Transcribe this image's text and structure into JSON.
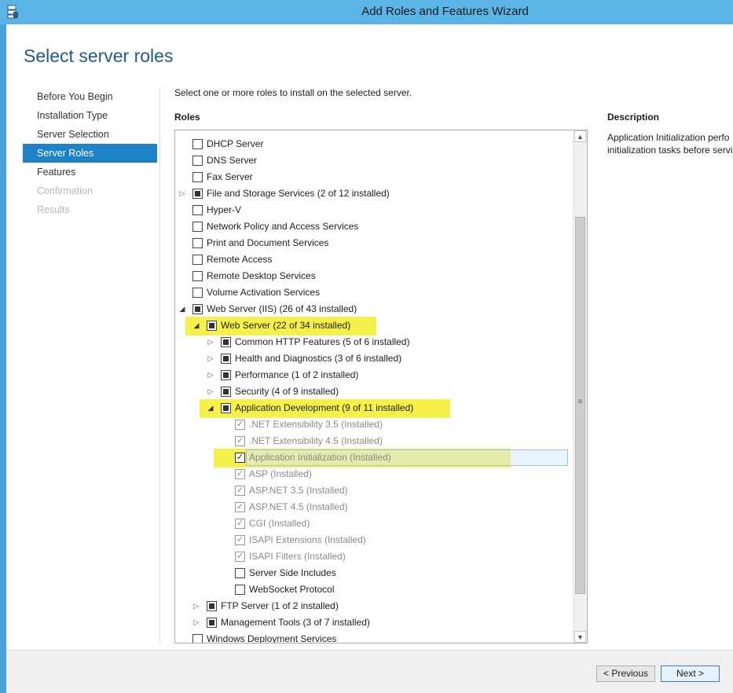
{
  "window": {
    "title": "Add Roles and Features Wizard"
  },
  "page": {
    "title": "Select server roles"
  },
  "nav": [
    {
      "label": "Before You Begin",
      "state": "normal"
    },
    {
      "label": "Installation Type",
      "state": "normal"
    },
    {
      "label": "Server Selection",
      "state": "normal"
    },
    {
      "label": "Server Roles",
      "state": "active"
    },
    {
      "label": "Features",
      "state": "normal"
    },
    {
      "label": "Confirmation",
      "state": "disabled"
    },
    {
      "label": "Results",
      "state": "disabled"
    }
  ],
  "instruction": "Select one or more roles to install on the selected server.",
  "roles_label": "Roles",
  "description": {
    "label": "Description",
    "text": "Application Initialization perfo\ninitialization tasks before servi"
  },
  "roles": [
    {
      "label": "DHCP Server",
      "level": 0,
      "expander": "none",
      "check": "empty"
    },
    {
      "label": "DNS Server",
      "level": 0,
      "expander": "none",
      "check": "empty"
    },
    {
      "label": "Fax Server",
      "level": 0,
      "expander": "none",
      "check": "empty"
    },
    {
      "label": "File and Storage Services (2 of 12 installed)",
      "level": 0,
      "expander": "collapsed",
      "check": "indeterminate"
    },
    {
      "label": "Hyper-V",
      "level": 0,
      "expander": "none",
      "check": "empty"
    },
    {
      "label": "Network Policy and Access Services",
      "level": 0,
      "expander": "none",
      "check": "empty"
    },
    {
      "label": "Print and Document Services",
      "level": 0,
      "expander": "none",
      "check": "empty"
    },
    {
      "label": "Remote Access",
      "level": 0,
      "expander": "none",
      "check": "empty"
    },
    {
      "label": "Remote Desktop Services",
      "level": 0,
      "expander": "none",
      "check": "empty"
    },
    {
      "label": "Volume Activation Services",
      "level": 0,
      "expander": "none",
      "check": "empty"
    },
    {
      "label": "Web Server (IIS) (26 of 43 installed)",
      "level": 0,
      "expander": "expanded",
      "check": "indeterminate"
    },
    {
      "label": "Web Server (22 of 34 installed)",
      "level": 1,
      "expander": "expanded",
      "check": "indeterminate",
      "highlight": true
    },
    {
      "label": "Common HTTP Features (5 of 6 installed)",
      "level": 2,
      "expander": "collapsed",
      "check": "indeterminate"
    },
    {
      "label": "Health and Diagnostics (3 of 6 installed)",
      "level": 2,
      "expander": "collapsed",
      "check": "indeterminate"
    },
    {
      "label": "Performance (1 of 2 installed)",
      "level": 2,
      "expander": "collapsed",
      "check": "indeterminate"
    },
    {
      "label": "Security (4 of 9 installed)",
      "level": 2,
      "expander": "collapsed",
      "check": "indeterminate"
    },
    {
      "label": "Application Development (9 of 11 installed)",
      "level": 2,
      "expander": "expanded",
      "check": "indeterminate",
      "highlight": true
    },
    {
      "label": ".NET Extensibility 3.5 (Installed)",
      "level": 3,
      "expander": "none",
      "check": "checked",
      "grayed": true
    },
    {
      "label": ".NET Extensibility 4.5 (Installed)",
      "level": 3,
      "expander": "none",
      "check": "checked",
      "grayed": true
    },
    {
      "label": "Application Initialization (Installed)",
      "level": 3,
      "expander": "none",
      "check": "checked",
      "grayed": true,
      "highlight": true,
      "selected": true
    },
    {
      "label": "ASP (Installed)",
      "level": 3,
      "expander": "none",
      "check": "checked",
      "grayed": true
    },
    {
      "label": "ASP.NET 3.5 (Installed)",
      "level": 3,
      "expander": "none",
      "check": "checked",
      "grayed": true
    },
    {
      "label": "ASP.NET 4.5 (Installed)",
      "level": 3,
      "expander": "none",
      "check": "checked",
      "grayed": true
    },
    {
      "label": "CGI (Installed)",
      "level": 3,
      "expander": "none",
      "check": "checked",
      "grayed": true
    },
    {
      "label": "ISAPI Extensions (Installed)",
      "level": 3,
      "expander": "none",
      "check": "checked",
      "grayed": true
    },
    {
      "label": "ISAPI Filters (Installed)",
      "level": 3,
      "expander": "none",
      "check": "checked",
      "grayed": true
    },
    {
      "label": "Server Side Includes",
      "level": 3,
      "expander": "none",
      "check": "empty"
    },
    {
      "label": "WebSocket Protocol",
      "level": 3,
      "expander": "none",
      "check": "empty"
    },
    {
      "label": "FTP Server (1 of 2 installed)",
      "level": 1,
      "expander": "collapsed",
      "check": "indeterminate"
    },
    {
      "label": "Management Tools (3 of 7 installed)",
      "level": 1,
      "expander": "collapsed",
      "check": "indeterminate"
    },
    {
      "label": "Windows Deployment Services",
      "level": 0,
      "expander": "none",
      "check": "empty"
    }
  ],
  "buttons": {
    "previous": "< Previous",
    "next": "Next >"
  },
  "colors": {
    "title_bar": "#5bb4e6",
    "accent": "#1d83c6",
    "highlight": "#f6f04a"
  }
}
